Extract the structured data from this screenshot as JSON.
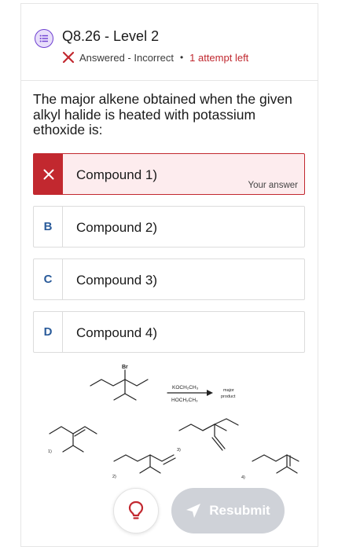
{
  "header": {
    "question_title": "Q8.26 - Level 2",
    "status": "Answered - Incorrect",
    "separator": "•",
    "attempts": "1 attempt left"
  },
  "question": {
    "text": "The major alkene obtained when the given alkyl halide is heated with potassium ethoxide is:"
  },
  "options": [
    {
      "letter": "",
      "label": "Compound 1)",
      "note": "Your answer",
      "state": "incorrect"
    },
    {
      "letter": "B",
      "label": "Compound 2)"
    },
    {
      "letter": "C",
      "label": "Compound 3)"
    },
    {
      "letter": "D",
      "label": "Compound 4)"
    }
  ],
  "scheme": {
    "halogen": "Br",
    "reagent_top": "KOCH₂CH₃",
    "reagent_bottom": "HOCH₂CH₃",
    "product_line1": "major",
    "product_line2": "product",
    "labels": [
      "1)",
      "2)",
      "3)",
      "4)"
    ]
  },
  "footer": {
    "resubmit_label": "Resubmit"
  },
  "colors": {
    "error": "#c2282f",
    "accent": "#6d3fd1",
    "letter": "#2a5b9a",
    "disabled_button": "#cfd2d8",
    "hint_icon": "#c2282f"
  },
  "icons": {
    "question_icon": "list-icon",
    "status_icon": "x-icon",
    "hint_icon": "lightbulb-icon",
    "submit_icon": "send-icon"
  }
}
